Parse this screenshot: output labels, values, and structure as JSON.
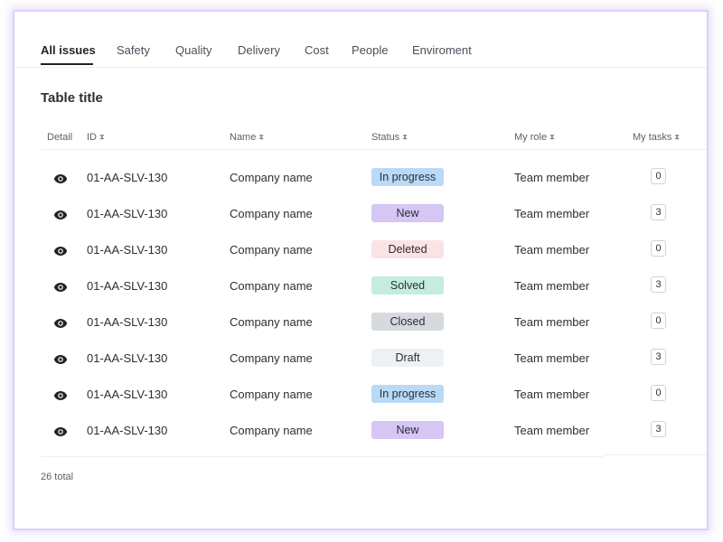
{
  "tabs": [
    {
      "label": "All issues",
      "active": true
    },
    {
      "label": "Safety"
    },
    {
      "label": "Quality"
    },
    {
      "label": "Delivery"
    },
    {
      "label": "Cost"
    },
    {
      "label": "People"
    },
    {
      "label": "Enviroment"
    }
  ],
  "table": {
    "title": "Table title",
    "columns": [
      "Detail",
      "ID",
      "Name",
      "Status",
      "My role",
      "My tasks"
    ],
    "sort_icon": "sort-icon",
    "rows": [
      {
        "id": "01-AA-SLV-130",
        "name": "Company name",
        "status": "In progress",
        "role": "Team member",
        "tasks": "0"
      },
      {
        "id": "01-AA-SLV-130",
        "name": "Company name",
        "status": "New",
        "role": "Team member",
        "tasks": "3"
      },
      {
        "id": "01-AA-SLV-130",
        "name": "Company name",
        "status": "Deleted",
        "role": "Team member",
        "tasks": "0"
      },
      {
        "id": "01-AA-SLV-130",
        "name": "Company name",
        "status": "Solved",
        "role": "Team member",
        "tasks": "3"
      },
      {
        "id": "01-AA-SLV-130",
        "name": "Company name",
        "status": "Closed",
        "role": "Team member",
        "tasks": "0"
      },
      {
        "id": "01-AA-SLV-130",
        "name": "Company name",
        "status": "Draft",
        "role": "Team member",
        "tasks": "3"
      },
      {
        "id": "01-AA-SLV-130",
        "name": "Company name",
        "status": "In progress",
        "role": "Team member",
        "tasks": "0"
      },
      {
        "id": "01-AA-SLV-130",
        "name": "Company name",
        "status": "New",
        "role": "Team member",
        "tasks": "3"
      }
    ],
    "detail_icon": "eye-icon",
    "total": "26 total"
  },
  "status_colors": {
    "In progress": "#b9daf7",
    "New": "#d5c6f3",
    "Deleted": "#fbe3e3",
    "Solved": "#c4ecdf",
    "Closed": "#d6dade",
    "Draft": "#eef1f3"
  }
}
